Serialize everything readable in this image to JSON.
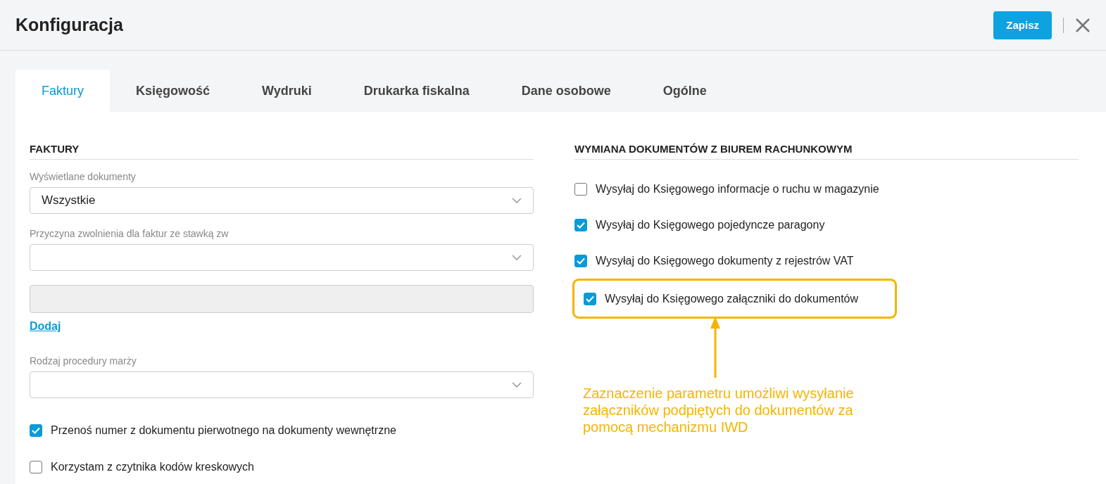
{
  "header": {
    "title": "Konfiguracja",
    "save_button": "Zapisz"
  },
  "tabs": [
    {
      "label": "Faktury",
      "selected": true
    },
    {
      "label": "Księgowość",
      "selected": false
    },
    {
      "label": "Wydruki",
      "selected": false
    },
    {
      "label": "Drukarka fiskalna",
      "selected": false
    },
    {
      "label": "Dane osobowe",
      "selected": false
    },
    {
      "label": "Ogólne",
      "selected": false
    }
  ],
  "left": {
    "section_title": "FAKTURY",
    "fields": [
      {
        "kind": "select",
        "label": "Wyświetlane dokumenty",
        "value": "Wszystkie"
      },
      {
        "kind": "select",
        "label": "Przyczyna zwolnienia dla faktur ze stawką zw"
      },
      {
        "kind": "text",
        "disabled": true
      },
      {
        "kind": "link",
        "text": "Dodaj"
      },
      {
        "kind": "select",
        "label": "Rodzaj procedury marży"
      }
    ],
    "checkboxes": [
      {
        "label": "Przenoś numer z dokumentu pierwotnego na dokumenty wewnętrzne",
        "checked": true
      },
      {
        "label": "Korzystam z czytnika kodów kreskowych",
        "checked": false
      }
    ]
  },
  "right": {
    "section_title": "WYMIANA DOKUMENTÓW Z BIUREM RACHUNKOWYM",
    "checkboxes": [
      {
        "label": "Wysyłaj do Księgowego informacje o ruchu w magazynie",
        "checked": false,
        "highlighted": false
      },
      {
        "label": "Wysyłaj do Księgowego pojedyncze paragony",
        "checked": true,
        "highlighted": false
      },
      {
        "label": "Wysyłaj do Księgowego dokumenty z rejestrów VAT",
        "checked": true,
        "highlighted": false
      },
      {
        "label": "Wysyłaj do Księgowego załączniki do dokumentów",
        "checked": true,
        "highlighted": true
      }
    ]
  },
  "annotation": {
    "text": "Zaznaczenie parametru umożliwi wysyłanie załączników podpiętych do dokumentów za pomocą mechanizmu IWD"
  }
}
